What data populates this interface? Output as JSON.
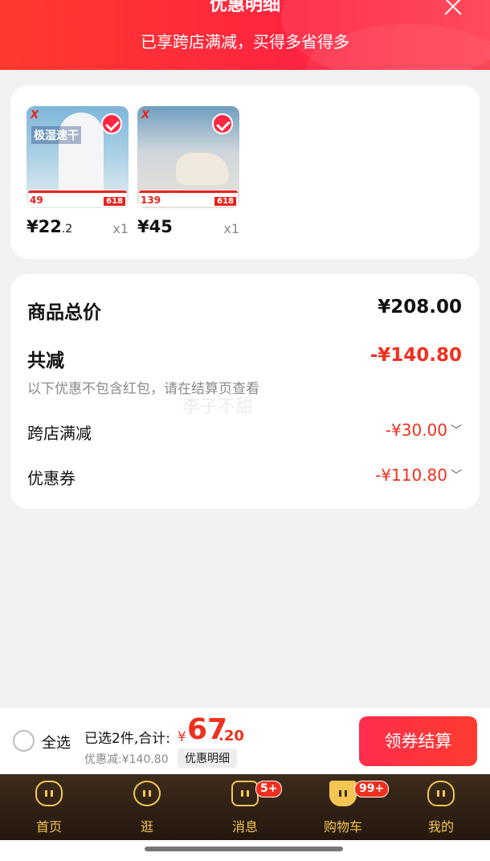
{
  "header": {
    "title": "优惠明细",
    "subtitle": "已享跨店满减，买得多省得多"
  },
  "products": [
    {
      "brand": "X",
      "slogan": "极湿速干",
      "strip_price": "49",
      "strip_tag": "618",
      "price_int": "¥22",
      "price_dec": ".2",
      "qty": "x1",
      "checked": true
    },
    {
      "brand": "X",
      "slogan": "",
      "strip_price": "139",
      "strip_tag": "618",
      "price_int": "¥45",
      "price_dec": "",
      "qty": "x1",
      "checked": true
    }
  ],
  "summary": {
    "total_label": "商品总价",
    "total_value": "¥208.00",
    "reduce_label": "共减",
    "reduce_value": "-¥140.80",
    "note": "以下优惠不包含红包，请在结算页查看",
    "cross_store_label": "跨店满减",
    "cross_store_value": "-¥30.00",
    "coupon_label": "优惠券",
    "coupon_value": "-¥110.80"
  },
  "watermark": "李子不甜",
  "checkout": {
    "select_all": "全选",
    "chosen": "已选2件,合计:",
    "currency": "¥",
    "total_int": "67",
    "total_dec": ".20",
    "discount": "优惠减:¥140.80",
    "detail_button": "优惠明细",
    "pay_button": "领券结算"
  },
  "tabs": [
    {
      "label": "首页",
      "icon": "home-icon"
    },
    {
      "label": "逛",
      "icon": "browse-icon"
    },
    {
      "label": "消息",
      "icon": "message-icon",
      "badge": "5+"
    },
    {
      "label": "购物车",
      "icon": "cart-icon",
      "badge": "99+"
    },
    {
      "label": "我的",
      "icon": "profile-icon"
    }
  ],
  "colors": {
    "accent_red": "#f0301f",
    "tab_gold": "#f3c653",
    "tab_bg": "#3e2c1c"
  }
}
